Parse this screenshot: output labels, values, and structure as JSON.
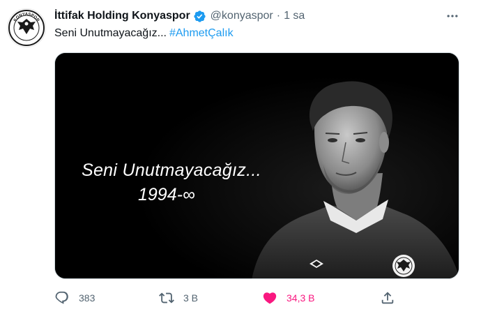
{
  "tweet": {
    "author_name": "İttifak Holding Konyaspor",
    "handle": "@konyaspor",
    "separator": "·",
    "time": "1 sa",
    "text": "Seni Unutmayacağız...",
    "hashtag": "#AhmetÇalık",
    "avatar_lettering": "KONYASPOR",
    "media": {
      "title": "Seni Unutmayacağız...",
      "years": "1994-∞",
      "badge_lettering": "KONYASPOR"
    },
    "actions": {
      "reply_count": "383",
      "retweet_count": "3 B",
      "like_count": "34,3 B"
    }
  },
  "colors": {
    "link": "#1d9bf0",
    "like": "#f91880",
    "secondary": "#536471",
    "verified": "#1d9bf0"
  },
  "icons": {
    "verified": "verified-badge-icon",
    "more": "more-icon",
    "reply": "reply-icon",
    "retweet": "retweet-icon",
    "like": "heart-icon",
    "share": "share-icon"
  }
}
